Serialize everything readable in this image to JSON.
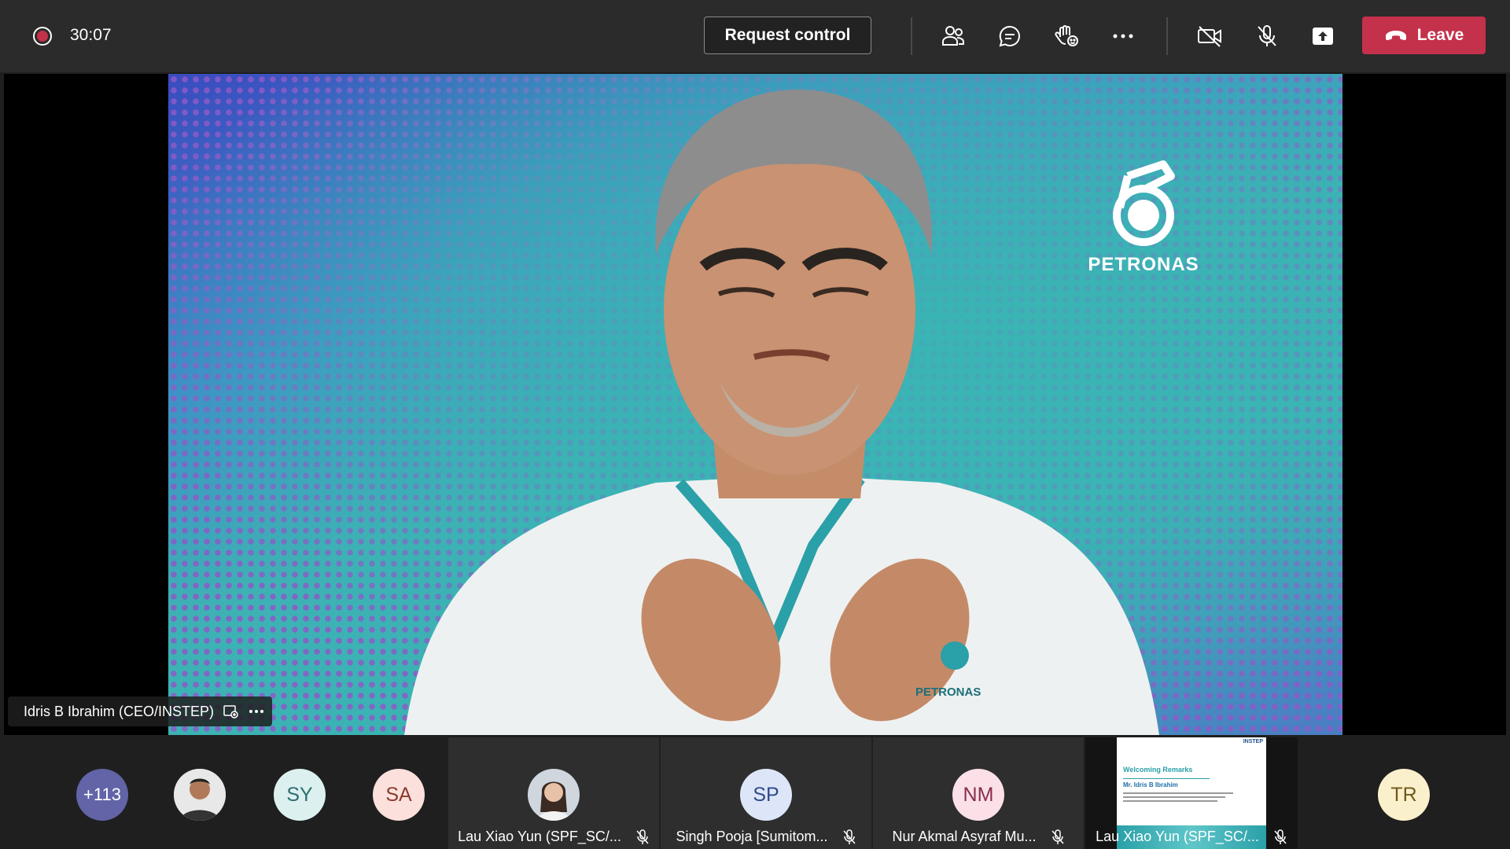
{
  "top_bar": {
    "timer": "30:07",
    "request_control_label": "Request control",
    "leave_label": "Leave",
    "icons": [
      "people-icon",
      "chat-icon",
      "raise-hand-icon",
      "more-icon",
      "camera-off-icon",
      "mic-off-icon",
      "share-icon"
    ]
  },
  "stage": {
    "presenter_name": "Idris B Ibrahim (CEO/INSTEP)",
    "background_logo_text": "PETRONAS",
    "shirt_logo_text": "PETRONAS"
  },
  "participants": {
    "overflow_count": "+113",
    "avatars": [
      {
        "initials": "SY",
        "color": "#dcf0f0"
      },
      {
        "initials": "SA",
        "color": "#fbe0dc"
      },
      {
        "initials": "SP",
        "color": "#dde6f8"
      },
      {
        "initials": "NM",
        "color": "#fbe0e8"
      },
      {
        "initials": "TR",
        "color": "#fbf0cc"
      }
    ],
    "tiles": [
      {
        "name": "Lau Xiao Yun (SPF_SC/..."
      },
      {
        "name": "Singh Pooja [Sumitom..."
      },
      {
        "name": "Nur Akmal Asyraf Mu..."
      },
      {
        "name": "Lau Xiao Yun (SPF_SC/..."
      }
    ],
    "slide": {
      "brand": "INSTEP",
      "title": "Welcoming Remarks",
      "speaker": "Mr. Idris B Ibrahim"
    }
  },
  "colors": {
    "leave": "#c4314b",
    "overflow_badge": "#6264a7",
    "topbar": "#2b2b2b"
  }
}
